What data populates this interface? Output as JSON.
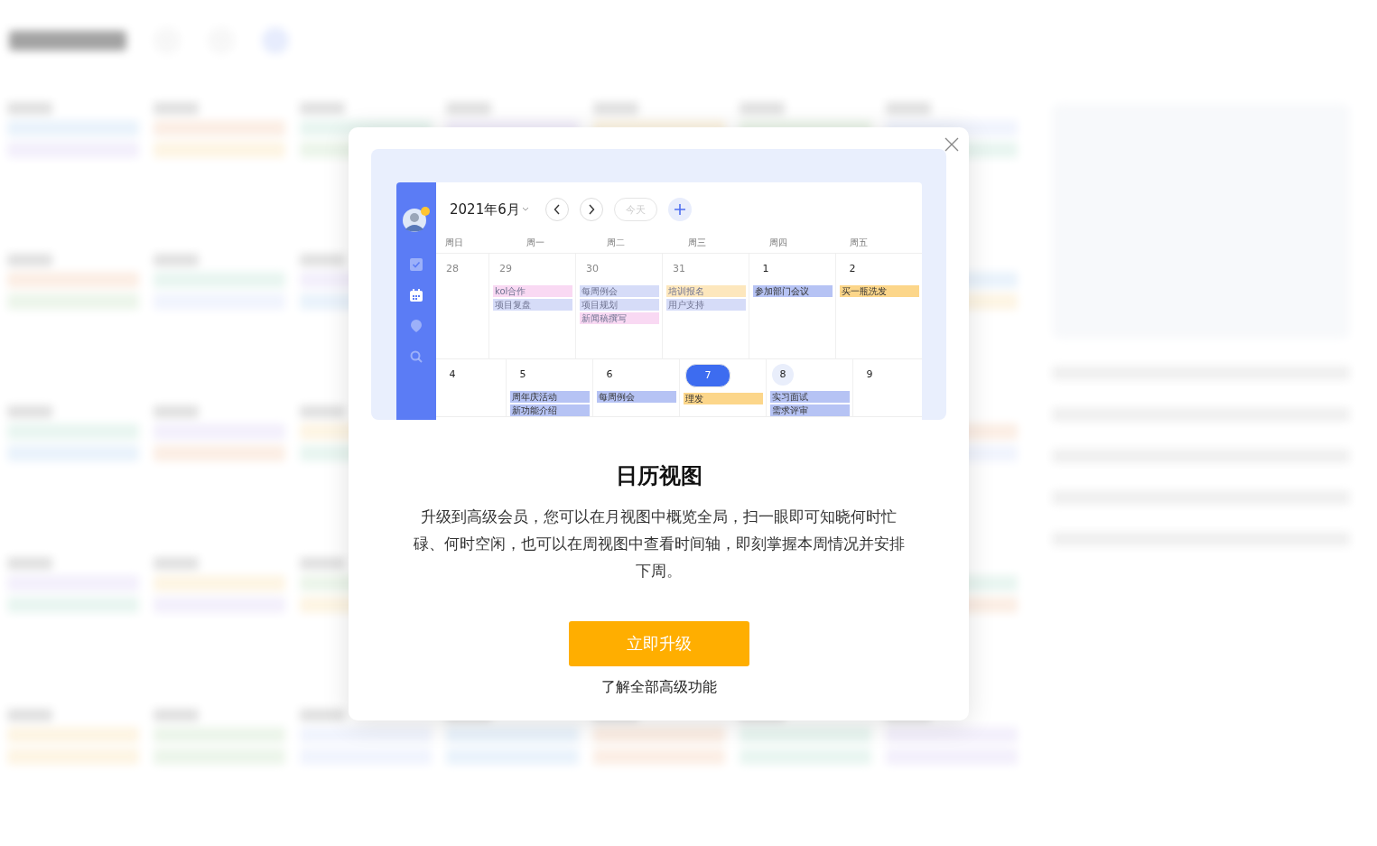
{
  "dialog": {
    "preview": {
      "sidebar": [
        {
          "kind": "tasks",
          "selected": false
        },
        {
          "kind": "calendar",
          "selected": true
        },
        {
          "kind": "pin",
          "selected": false
        },
        {
          "kind": "search",
          "selected": false
        }
      ],
      "month_title": "2021年6月",
      "today_button": "今天",
      "weekdays": [
        "周日",
        "周一",
        "周二",
        "周三",
        "周四",
        "周五"
      ],
      "weeks": [
        {
          "days": [
            {
              "date": "28",
              "past": true,
              "today": false,
              "selected": false
            },
            {
              "date": "29",
              "past": true,
              "today": false,
              "selected": false,
              "events": [
                {
                  "title": "kol合作",
                  "color": "#f9d9f3"
                },
                {
                  "title": "项目复盘",
                  "color": "#d6dcf8"
                }
              ]
            },
            {
              "date": "30",
              "past": true,
              "today": false,
              "selected": false,
              "events": [
                {
                  "title": "每周例会",
                  "color": "#d6dcf8"
                },
                {
                  "title": "项目规划",
                  "color": "#d6dcf8"
                },
                {
                  "title": "新闻稿撰写",
                  "color": "#f9d9f3"
                }
              ]
            },
            {
              "date": "31",
              "past": true,
              "today": false,
              "selected": false,
              "events": [
                {
                  "title": "培训报名",
                  "color": "#fde7bd"
                },
                {
                  "title": "用户支持",
                  "color": "#d6dcf8"
                }
              ]
            },
            {
              "date": "1",
              "past": false,
              "today": false,
              "selected": false,
              "events": [
                {
                  "title": "参加部门会议",
                  "color": "#b6c3f4"
                }
              ]
            },
            {
              "date": "2",
              "past": false,
              "today": false,
              "selected": false,
              "events": [
                {
                  "title": "买一瓶洗发",
                  "color": "#fcd68a"
                }
              ]
            }
          ]
        },
        {
          "days": [
            {
              "date": "4",
              "past": false,
              "today": false,
              "selected": false
            },
            {
              "date": "5",
              "past": false,
              "today": false,
              "selected": false,
              "events": [
                {
                  "title": "周年庆活动",
                  "color": "#b6c3f4"
                },
                {
                  "title": "新功能介绍",
                  "color": "#b6c3f4"
                }
              ]
            },
            {
              "date": "6",
              "past": false,
              "today": false,
              "selected": false,
              "events": [
                {
                  "title": "每周例会",
                  "color": "#b6c3f4"
                }
              ]
            },
            {
              "date": "7",
              "past": false,
              "today": true,
              "selected": false,
              "events": [
                {
                  "title": "理发",
                  "color": "#fcd68a"
                }
              ]
            },
            {
              "date": "8",
              "past": false,
              "today": false,
              "selected": true,
              "events": [
                {
                  "title": "实习面试",
                  "color": "#b6c3f4"
                },
                {
                  "title": "需求评审",
                  "color": "#b6c3f4"
                }
              ]
            },
            {
              "date": "9",
              "past": false,
              "today": false,
              "selected": false
            }
          ]
        }
      ]
    },
    "title": "日历视图",
    "description": "升级到高级会员，您可以在月视图中概览全局，扫一眼即可知晓何时忙碌、何时空闲，也可以在周视图中查看时间轴，即刻掌握本周情况并安排下周。",
    "upgrade_button": "立即升级",
    "learn_more_link": "了解全部高级功能"
  }
}
